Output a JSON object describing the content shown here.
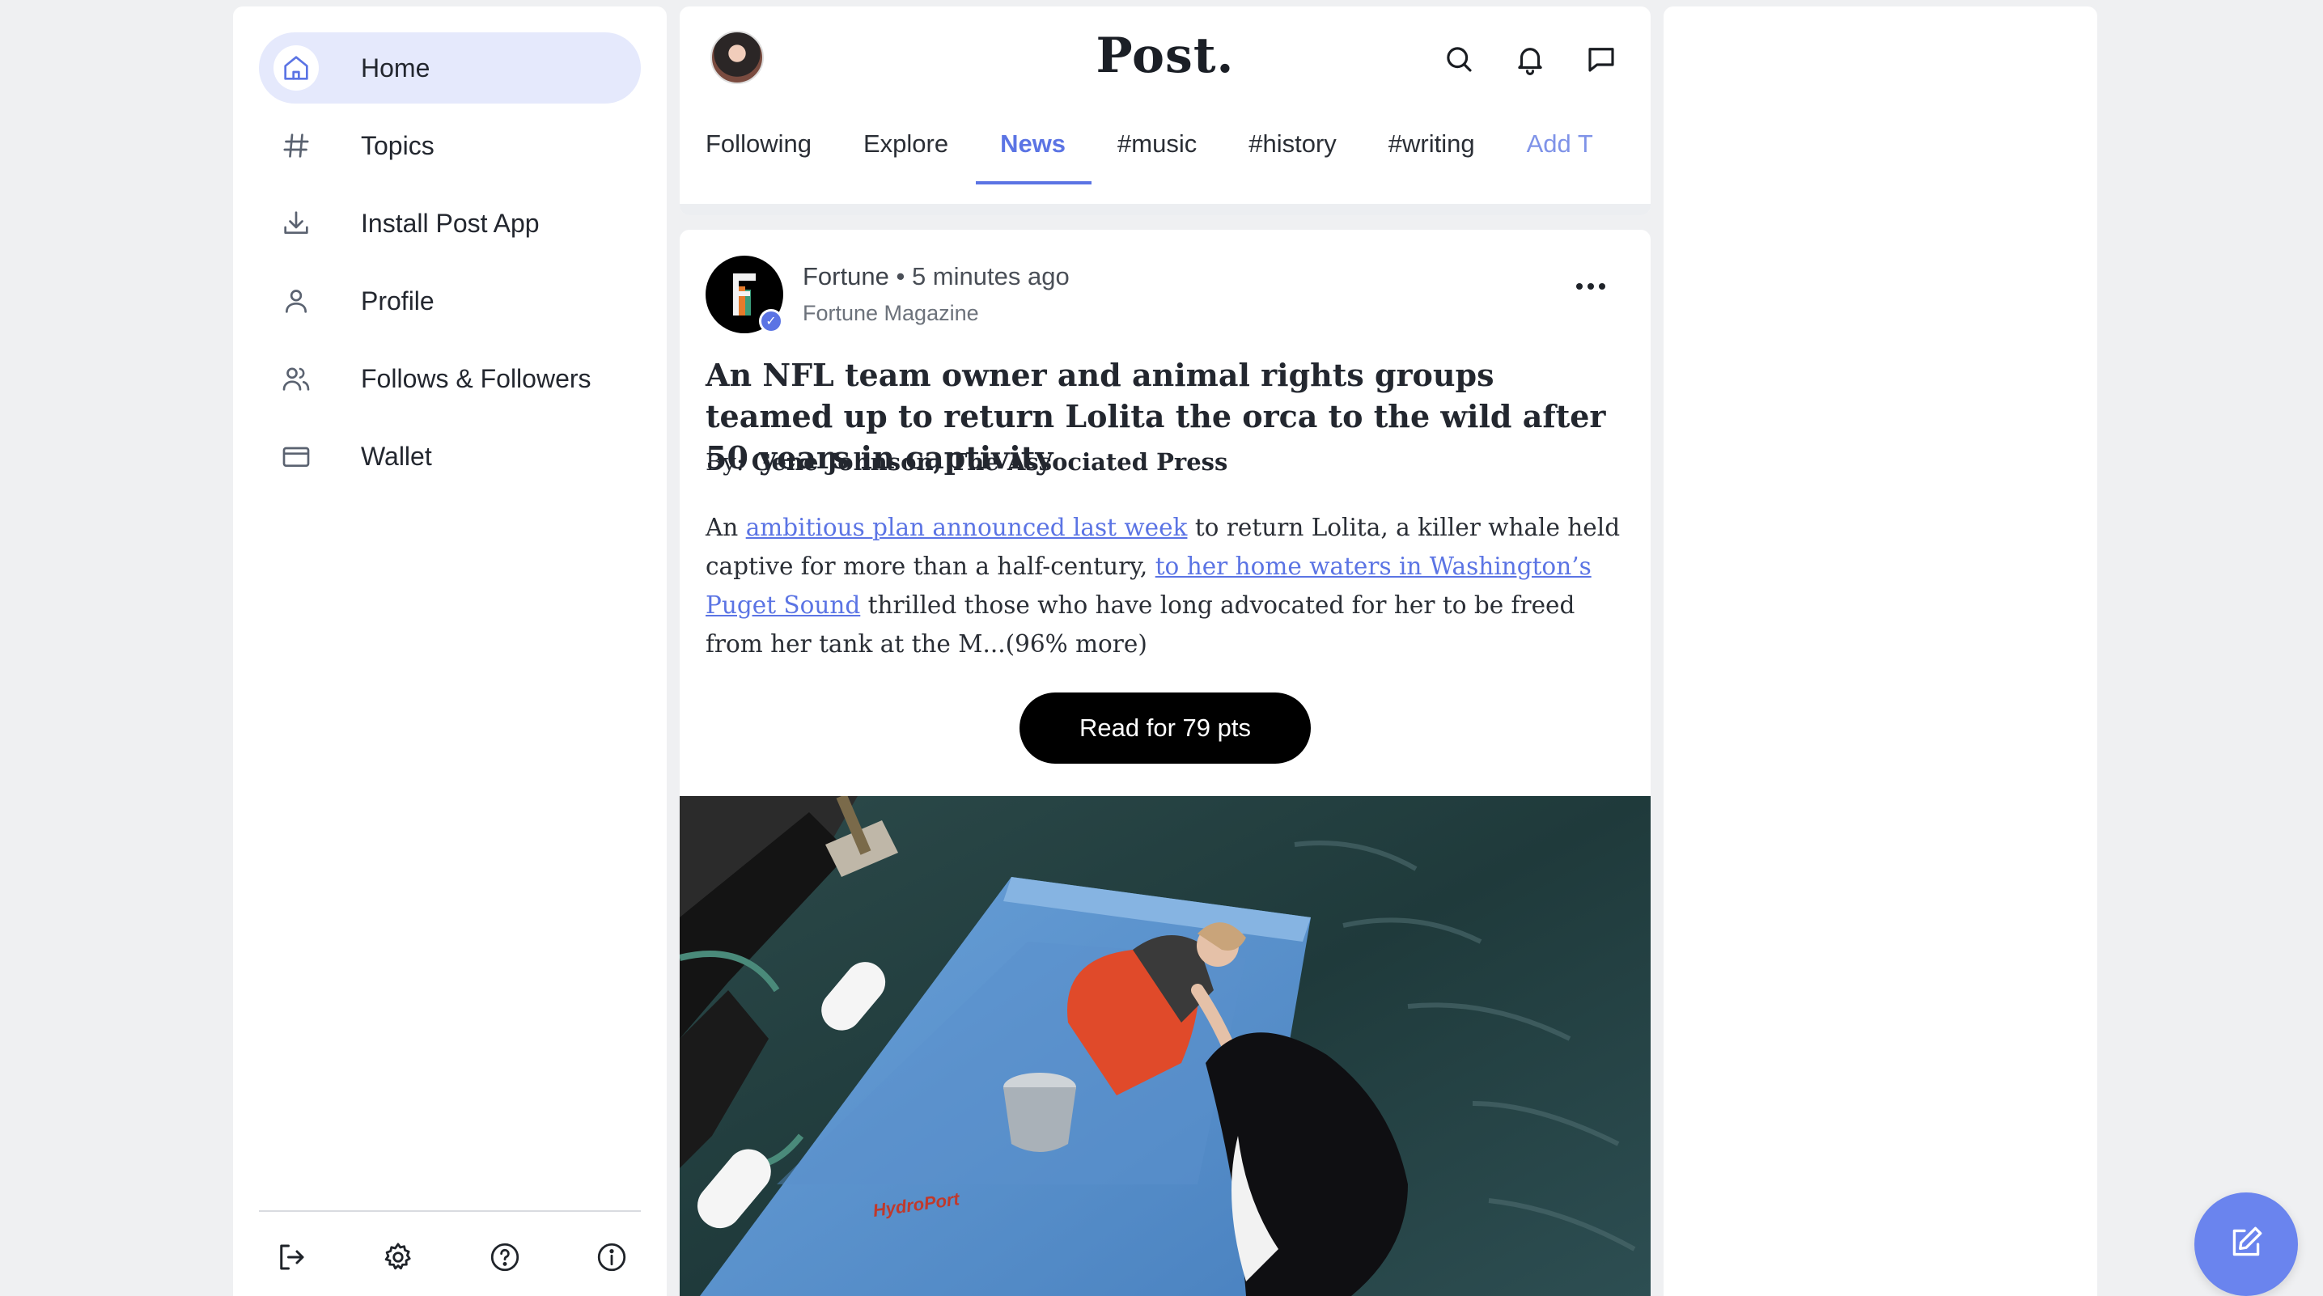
{
  "sidebar": {
    "items": [
      {
        "label": "Home",
        "icon": "home-icon",
        "active": true
      },
      {
        "label": "Topics",
        "icon": "hash-icon"
      },
      {
        "label": "Install Post App",
        "icon": "download-icon"
      },
      {
        "label": "Profile",
        "icon": "user-icon"
      },
      {
        "label": "Follows & Followers",
        "icon": "users-icon"
      },
      {
        "label": "Wallet",
        "icon": "wallet-icon"
      }
    ],
    "footer_icons": [
      "logout-icon",
      "settings-icon",
      "help-icon",
      "info-icon"
    ]
  },
  "header": {
    "logo": "Post.",
    "icons": [
      "search-icon",
      "bell-icon",
      "message-icon"
    ],
    "tabs": [
      {
        "label": "Following"
      },
      {
        "label": "Explore"
      },
      {
        "label": "News",
        "active": true
      },
      {
        "label": "#music"
      },
      {
        "label": "#history"
      },
      {
        "label": "#writing"
      },
      {
        "label": "Add T"
      }
    ]
  },
  "post": {
    "publisher": "Fortune",
    "separator": "•",
    "time": "5 minutes ago",
    "subtitle": "Fortune Magazine",
    "title": "An NFL team owner and animal rights groups teamed up to return Lolita the orca to the wild after 50 years in captivity",
    "byline_prefix": "By:",
    "byline_author": "Gene Johnson, The Associated Press",
    "excerpt": {
      "t1": "An ",
      "link1": "ambitious plan announced last week",
      "t2": " to return Lolita, a killer whale held captive for more than a half-century, ",
      "link2": "to her home waters in Washington’s Puget Sound",
      "t3": " thrilled those who have long advocated for her to be freed from her tank at the M...(96% more)"
    },
    "read_button": "Read for 79 pts",
    "image_text": "HydroPort"
  },
  "colors": {
    "accent": "#5b74e4",
    "active_bg": "#e5e9fc",
    "fab": "#6a84ee"
  }
}
